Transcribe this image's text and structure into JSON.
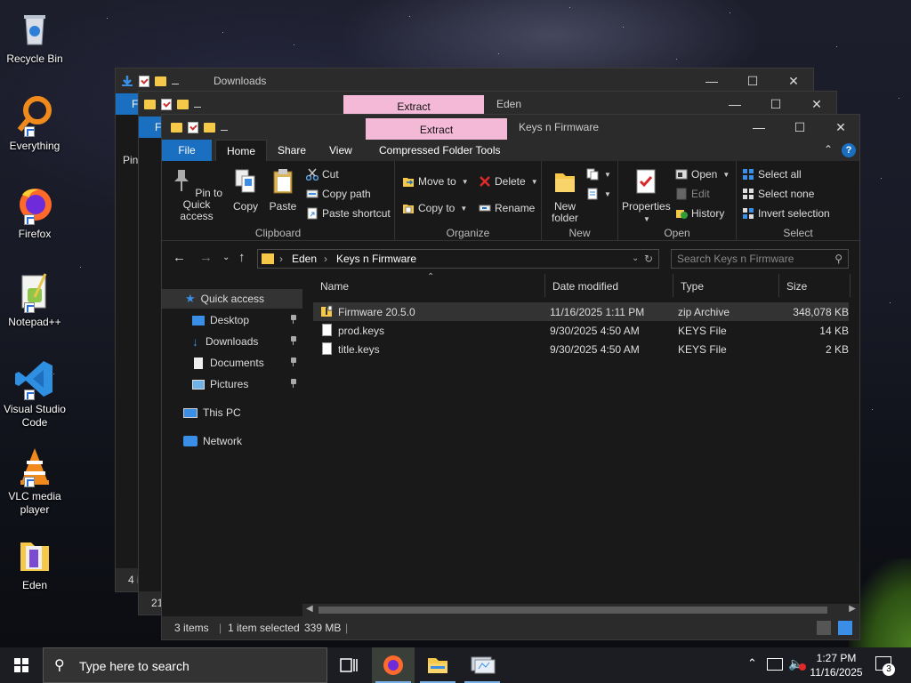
{
  "desktop": {
    "icons": [
      {
        "label": "Recycle Bin",
        "icon": "recycle-bin-icon"
      },
      {
        "label": "Everything",
        "icon": "everything-search-icon"
      },
      {
        "label": "Firefox",
        "icon": "firefox-icon"
      },
      {
        "label": "Notepad++",
        "icon": "notepadpp-icon"
      },
      {
        "label": "Visual Studio Code",
        "line1": "Visual Studio",
        "line2": "Code",
        "icon": "vscode-icon"
      },
      {
        "label": "VLC media player",
        "line1": "VLC media",
        "line2": "player",
        "icon": "vlc-icon"
      },
      {
        "label": "Eden",
        "icon": "eden-icon"
      }
    ]
  },
  "back_window_1": {
    "title": "Downloads",
    "partial_tab": "F",
    "partial_left": "Pin",
    "status": "4 i"
  },
  "back_window_2": {
    "title": "Eden",
    "extract_tab": "Extract",
    "partial_tab": "F",
    "status": "21"
  },
  "front_window": {
    "title": "Keys n Firmware",
    "extract_tab": "Extract",
    "tabs": [
      "File",
      "Home",
      "Share",
      "View",
      "Compressed Folder Tools"
    ],
    "ribbon": {
      "clipboard": {
        "label": "Clipboard",
        "pin_line1": "Pin to Quick",
        "pin_line2": "access",
        "copy": "Copy",
        "paste": "Paste",
        "cut": "Cut",
        "copy_path": "Copy path",
        "paste_shortcut": "Paste shortcut"
      },
      "organize": {
        "label": "Organize",
        "move_to": "Move to",
        "copy_to": "Copy to",
        "delete": "Delete",
        "rename": "Rename"
      },
      "new": {
        "label": "New",
        "new_folder_line1": "New",
        "new_folder_line2": "folder"
      },
      "open": {
        "label": "Open",
        "properties": "Properties",
        "open": "Open",
        "edit": "Edit",
        "history": "History"
      },
      "select": {
        "label": "Select",
        "select_all": "Select all",
        "select_none": "Select none",
        "invert": "Invert selection"
      }
    },
    "address": {
      "crumbs": [
        "Eden",
        "Keys n Firmware"
      ],
      "search_placeholder": "Search Keys n Firmware"
    },
    "nav": {
      "quick_access": "Quick access",
      "pinned": [
        "Desktop",
        "Downloads",
        "Documents",
        "Pictures"
      ],
      "this_pc": "This PC",
      "network": "Network"
    },
    "columns": [
      "Name",
      "Date modified",
      "Type",
      "Size"
    ],
    "files": [
      {
        "name": "Firmware 20.5.0",
        "date": "11/16/2025 1:11 PM",
        "type": "zip Archive",
        "size": "348,078 KB",
        "selected": true
      },
      {
        "name": "prod.keys",
        "date": "9/30/2025 4:50 AM",
        "type": "KEYS File",
        "size": "14 KB",
        "selected": false
      },
      {
        "name": "title.keys",
        "date": "9/30/2025 4:50 AM",
        "type": "KEYS File",
        "size": "2 KB",
        "selected": false
      }
    ],
    "status": {
      "items": "3 items",
      "selected": "1 item selected",
      "size": "339 MB"
    }
  },
  "taskbar": {
    "search_placeholder": "Type here to search",
    "time": "1:27 PM",
    "date": "11/16/2025",
    "notifications": "3"
  },
  "colors": {
    "accent": "#1a6fc1",
    "extract_tab": "#f5b9d8",
    "window_bg": "#191919",
    "titlebar_bg": "#2b2b2b"
  }
}
